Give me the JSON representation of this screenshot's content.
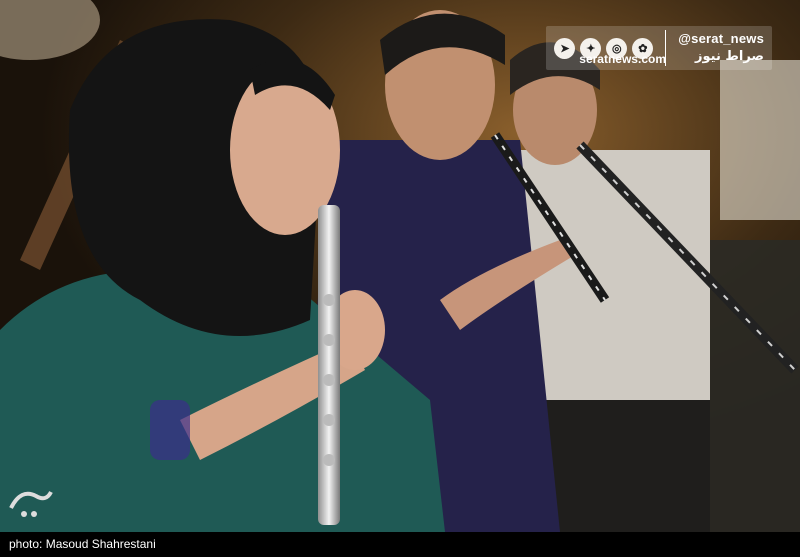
{
  "watermark": {
    "social_icons": [
      "telegram-icon",
      "twitter-icon",
      "instagram-icon",
      "aparat-icon"
    ],
    "handle": "@serat_news",
    "handle_fa": "صراط نیوز",
    "site": "seratnews.com"
  },
  "caption": "photo: Masoud Shahrestani",
  "colors": {
    "shirt_teal": "#1f5a55",
    "shirt_navy": "#25224a",
    "caption_bg": "#000000"
  }
}
